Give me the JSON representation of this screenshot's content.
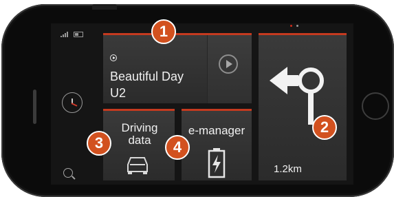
{
  "colors": {
    "accent": "#c53a1f",
    "badge": "#d2511f",
    "tile": "#333333"
  },
  "status": {
    "signal": "signal-icon",
    "battery": "battery-icon"
  },
  "music": {
    "title": "Beautiful Day",
    "artist": "U2"
  },
  "navigation": {
    "distance": "1.2km",
    "icon": "roundabout-left-icon"
  },
  "tiles": {
    "driving_data": "Driving data",
    "emanager": "e-manager"
  },
  "badges": [
    "1",
    "2",
    "3",
    "4"
  ]
}
